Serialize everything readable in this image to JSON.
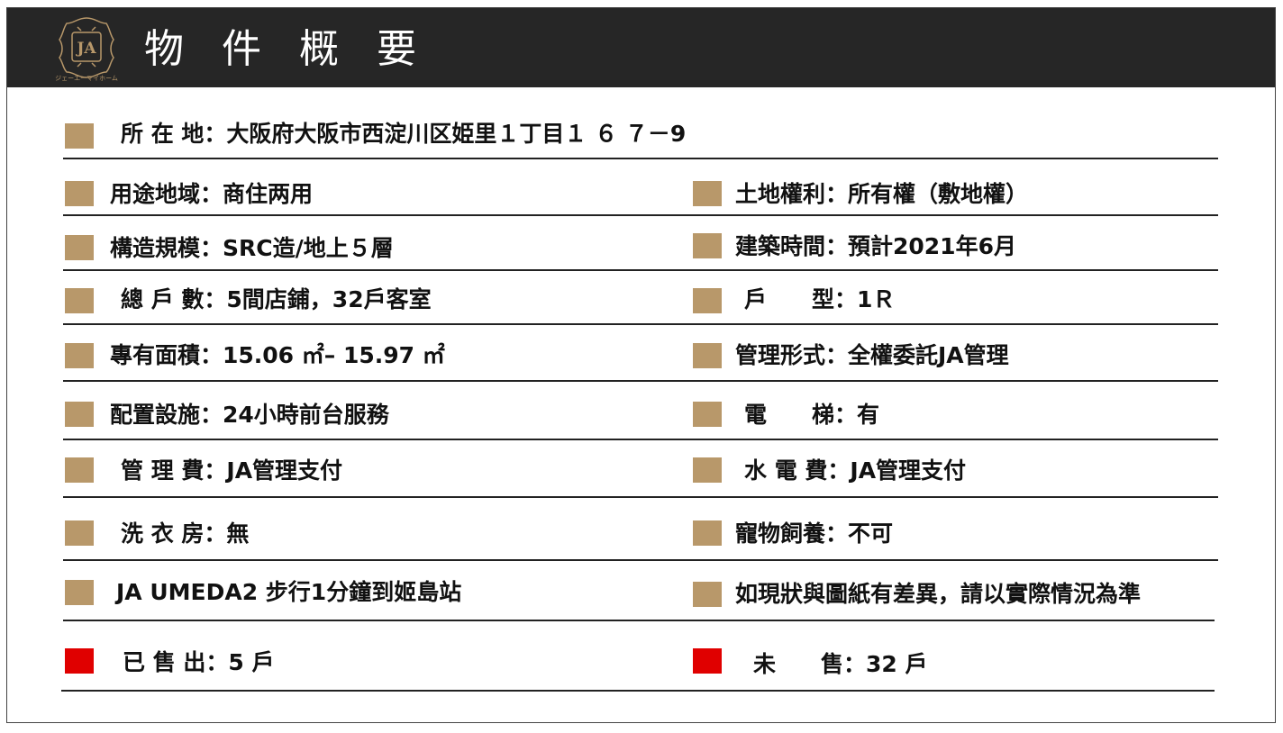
{
  "header": {
    "title": "物 件 概 要",
    "logo_text": "ジェーエーマイホーム",
    "logo_mark": "JA",
    "accent_gold": "#b8986a",
    "bar_color": "#262626"
  },
  "rows": [
    {
      "text": "所 在 地：大阪府大阪市西淀川区姫里１丁目１ ６ ７－9",
      "marker": "#b8986a"
    },
    {
      "text": "用途地域：商住两用",
      "marker": "#b8986a"
    },
    {
      "text": "土地權利：所有權（敷地權）",
      "marker": "#b8986a"
    },
    {
      "text": "構造規模：SRC造/地上５層",
      "marker": "#b8986a"
    },
    {
      "text": "建築時間：預計2021年6月",
      "marker": "#b8986a"
    },
    {
      "text": "總 戶 數：5間店鋪，32戶客室",
      "marker": "#b8986a"
    },
    {
      "text": "戶　　型：1Ｒ",
      "marker": "#b8986a"
    },
    {
      "text": "專有面積：15.06 ㎡– 15.97 ㎡",
      "marker": "#b8986a"
    },
    {
      "text": "管理形式：全權委託JA管理",
      "marker": "#b8986a"
    },
    {
      "text": "配置設施：24小時前台服務",
      "marker": "#b8986a"
    },
    {
      "text": "電　　梯：有",
      "marker": "#b8986a"
    },
    {
      "text": "管 理 費：JA管理支付",
      "marker": "#b8986a"
    },
    {
      "text": "水 電 費：JA管理支付",
      "marker": "#b8986a"
    },
    {
      "text": "洗 衣 房：無",
      "marker": "#b8986a"
    },
    {
      "text": "寵物飼養：不可",
      "marker": "#b8986a"
    },
    {
      "text": "JA UMEDA2 步行1分鐘到姬島站",
      "marker": "#b8986a"
    },
    {
      "text": "如現狀與圖紙有差異，請以實際情況為準",
      "marker": "#b8986a"
    },
    {
      "text": "已 售 出：5 戶",
      "marker": "#e00000"
    },
    {
      "text": "未　　售：32 戶",
      "marker": "#e00000"
    }
  ]
}
